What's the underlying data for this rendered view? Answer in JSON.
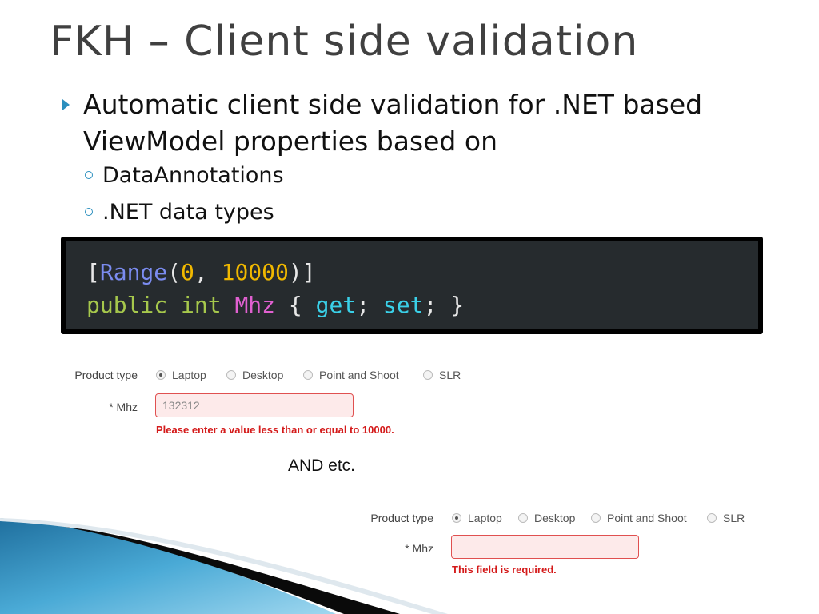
{
  "slide": {
    "title": "FKH – Client side validation",
    "bullet1": "Automatic client side validation for .NET based ViewModel properties based on",
    "sub_bullets": [
      "DataAnnotations",
      ".NET data types"
    ],
    "footer_text": "AND etc."
  },
  "code": {
    "line1": {
      "open": "[",
      "attr": "Range",
      "paren_open": "(",
      "num1": "0",
      "comma": ", ",
      "num2": "10000",
      "close": ")]"
    },
    "line2": {
      "kw1": "public",
      "kw2": "int",
      "prop": "Mhz",
      "brace_open": "{",
      "get": "get",
      "semi1": ";",
      "set": "set",
      "semi2": ";",
      "brace_close": "}"
    }
  },
  "form1": {
    "product_type_label": "Product type",
    "radios": [
      {
        "label": "Laptop",
        "checked": true
      },
      {
        "label": "Desktop",
        "checked": false
      },
      {
        "label": "Point and Shoot",
        "checked": false
      },
      {
        "label": "SLR",
        "checked": false
      }
    ],
    "mhz_label": "* Mhz",
    "mhz_value": "132312",
    "error": "Please enter a value less than or equal to 10000."
  },
  "form2": {
    "product_type_label": "Product type",
    "radios": [
      {
        "label": "Laptop",
        "checked": true
      },
      {
        "label": "Desktop",
        "checked": false
      },
      {
        "label": "Point and Shoot",
        "checked": false
      },
      {
        "label": "SLR",
        "checked": false
      }
    ],
    "mhz_label": "* Mhz",
    "mhz_value": "",
    "error": "This field is required."
  },
  "colors": {
    "accent": "#2b8fbe",
    "error": "#d41a1a",
    "code_bg": "#262b2e"
  }
}
